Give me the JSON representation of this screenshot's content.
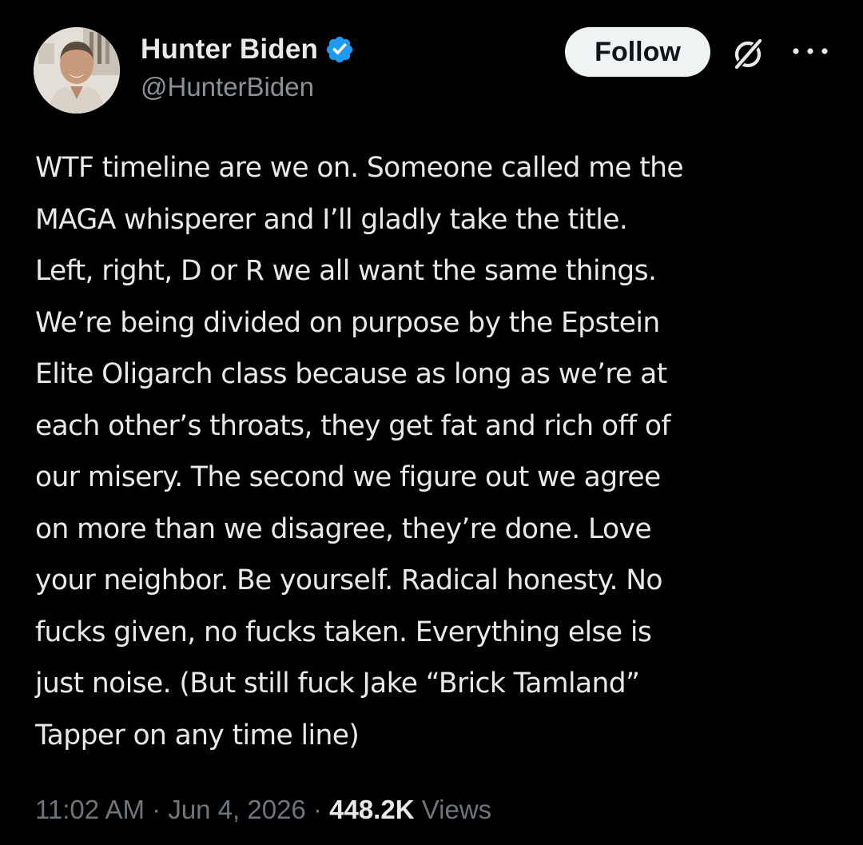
{
  "author": {
    "display_name": "Hunter Biden",
    "handle": "@HunterBiden",
    "verified": true,
    "avatar_icon": "profile-photo"
  },
  "actions": {
    "follow_label": "Follow",
    "grok_icon": "grok-slash-circle-icon",
    "more_icon": "more-horizontal-icon"
  },
  "tweet": {
    "lines": [
      "WTF timeline are we on. Someone called me the",
      "MAGA whisperer and I’ll gladly take the title.",
      "Left, right, D or R we all want the same things.",
      "We’re being divided on purpose by the Epstein",
      "Elite Oligarch class because as long as we’re at",
      "each other’s throats, they get fat and rich off of",
      "our misery. The second we figure out we agree",
      "on more than we disagree, they’re done. Love",
      "your neighbor. Be yourself. Radical honesty. No",
      "fucks given, no fucks taken. Everything else is",
      "just noise. (But still fuck Jake “Brick Tamland”",
      "Tapper on any time line)"
    ]
  },
  "meta": {
    "time": "11:02 AM",
    "separator": " · ",
    "date": "Jun 4, 2026",
    "views_count": "448.2K",
    "views_label": " Views"
  },
  "colors": {
    "background": "#000000",
    "text": "#e7e9ea",
    "secondary": "#8b9197",
    "verified_blue": "#1d9bf0",
    "button_bg": "#eff3f4"
  }
}
